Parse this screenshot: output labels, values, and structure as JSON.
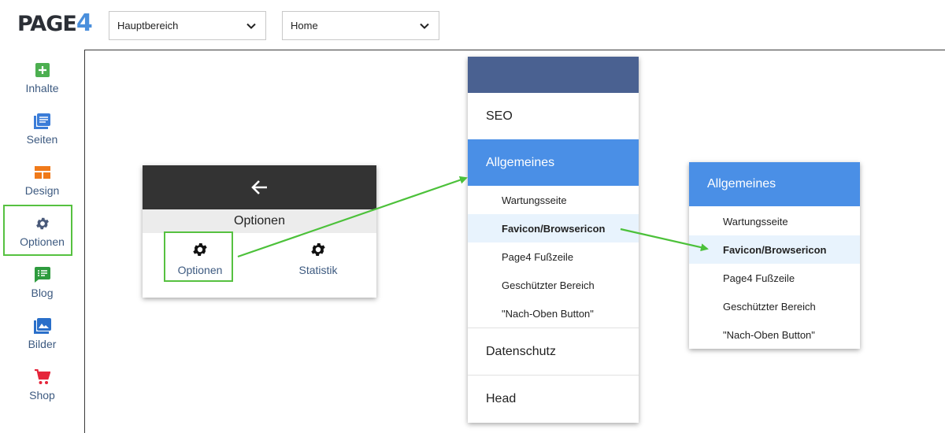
{
  "header": {
    "logo_main": "PAGE",
    "logo_num": "4",
    "selects": [
      {
        "value": "Hauptbereich"
      },
      {
        "value": "Home"
      }
    ]
  },
  "sidebar": {
    "items": [
      {
        "label": "Inhalte",
        "icon": "plus-square-icon",
        "color": "#4caf50"
      },
      {
        "label": "Seiten",
        "icon": "pages-icon",
        "color": "#3b7dd8"
      },
      {
        "label": "Design",
        "icon": "layout-icon",
        "color": "#f07a1a"
      },
      {
        "label": "Optionen",
        "icon": "gear-icon",
        "color": "#4a5a7a"
      },
      {
        "label": "Blog",
        "icon": "blog-icon",
        "color": "#2e9b3e"
      },
      {
        "label": "Bilder",
        "icon": "images-icon",
        "color": "#2a6fc9"
      },
      {
        "label": "Shop",
        "icon": "cart-icon",
        "color": "#e5253a"
      }
    ],
    "active": "Optionen"
  },
  "panel1": {
    "title": "Optionen",
    "buttons": [
      {
        "label": "Optionen",
        "icon": "gear-icon"
      },
      {
        "label": "Statistik",
        "icon": "gear-icon"
      }
    ]
  },
  "panel2": {
    "sections": [
      {
        "label": "SEO"
      },
      {
        "label": "Allgemeines"
      },
      {
        "label": "Datenschutz"
      },
      {
        "label": "Head"
      }
    ],
    "subitems": [
      {
        "label": "Wartungsseite"
      },
      {
        "label": "Favicon/Browsericon"
      },
      {
        "label": "Page4 Fußzeile"
      },
      {
        "label": "Geschützter Bereich"
      },
      {
        "label": "\"Nach-Oben Button\""
      }
    ]
  },
  "panel3": {
    "section": "Allgemeines",
    "subitems": [
      {
        "label": "Wartungsseite"
      },
      {
        "label": "Favicon/Browsericon"
      },
      {
        "label": "Page4 Fußzeile"
      },
      {
        "label": "Geschützter Bereich"
      },
      {
        "label": "\"Nach-Oben Button\""
      }
    ]
  },
  "colors": {
    "accent": "#4a8fe6",
    "highlight": "#56c140",
    "panel_header": "#4a6191"
  }
}
